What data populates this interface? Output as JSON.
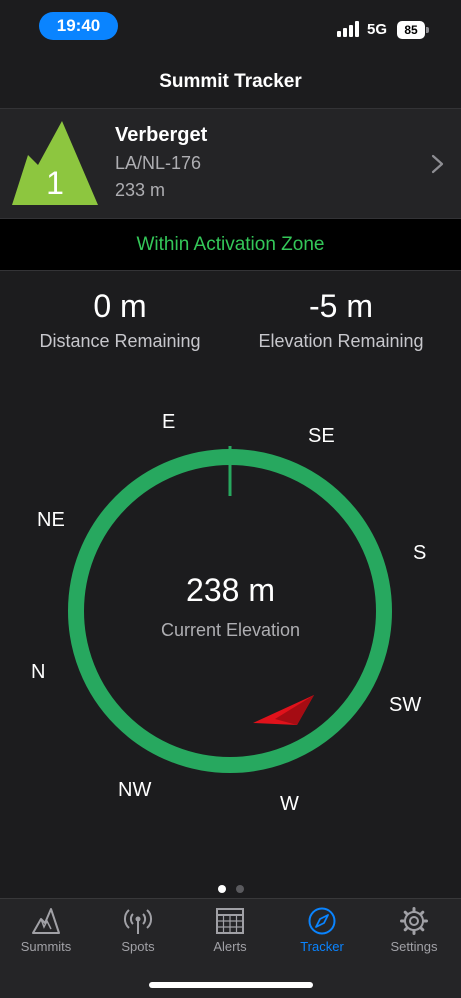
{
  "status_bar": {
    "time": "19:40",
    "network": "5G",
    "battery": "85"
  },
  "nav": {
    "title": "Summit Tracker"
  },
  "summit": {
    "points": "1",
    "name": "Verberget",
    "reference": "LA/NL-176",
    "height": "233 m",
    "badge_color": "#8dc63f"
  },
  "zone": {
    "status": "Within Activation Zone",
    "color": "#34c759"
  },
  "stats": {
    "distance": {
      "value": "0 m",
      "label": "Distance Remaining"
    },
    "elevation": {
      "value": "-5 m",
      "label": "Elevation Remaining"
    }
  },
  "compass": {
    "labels": {
      "E": "E",
      "SE": "SE",
      "S": "S",
      "SW": "SW",
      "W": "W",
      "NW": "NW",
      "N": "N",
      "NE": "NE"
    },
    "ring_color": "#27a85f",
    "pointer_color": "#e0121b",
    "current_elevation": "238 m",
    "current_elevation_label": "Current Elevation"
  },
  "pagination": {
    "current": 1,
    "total": 2
  },
  "tabs": [
    {
      "label": "Summits",
      "icon": "mountain-icon",
      "active": false
    },
    {
      "label": "Spots",
      "icon": "antenna-icon",
      "active": false
    },
    {
      "label": "Alerts",
      "icon": "calendar-icon",
      "active": false
    },
    {
      "label": "Tracker",
      "icon": "compass-icon",
      "active": true
    },
    {
      "label": "Settings",
      "icon": "gear-icon",
      "active": false
    }
  ],
  "colors": {
    "active_tab": "#0a84ff",
    "inactive_tab": "#a1a1a6"
  }
}
